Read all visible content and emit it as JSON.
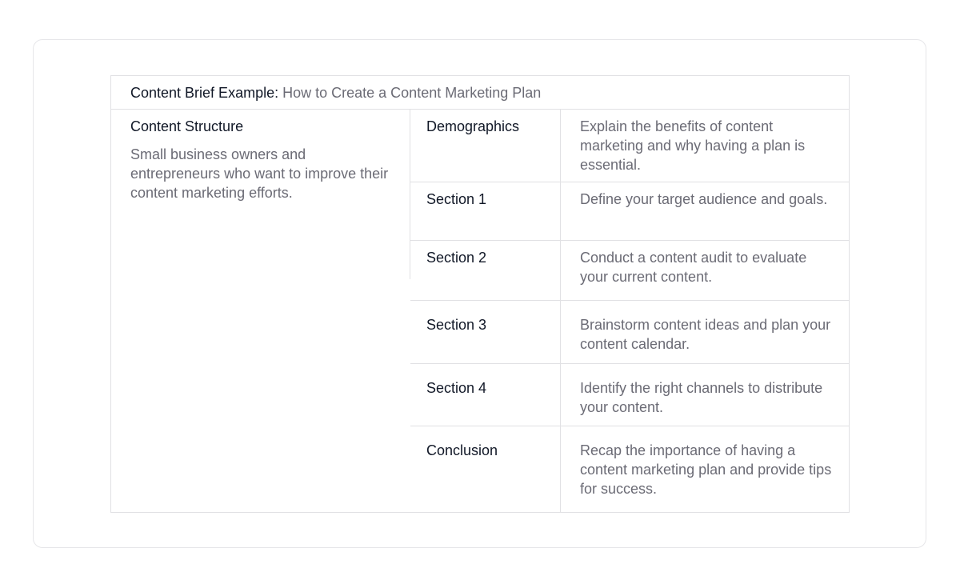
{
  "brief": {
    "header_label": "Content Brief Example:",
    "header_value": "How to Create a Content Marketing Plan"
  },
  "structure": {
    "title": "Content Structure",
    "description": "Small business owners and entrepreneurs who want to improve their content marketing efforts."
  },
  "rows": [
    {
      "name": "Demographics",
      "description": "Explain the benefits of content marketing and why having a plan is essential."
    },
    {
      "name": "Section 1",
      "description": "Define your target audience and goals."
    },
    {
      "name": "Section 2",
      "description": "Conduct a content audit to evaluate your current content."
    },
    {
      "name": "Section 3",
      "description": "Brainstorm content ideas and plan your content calendar."
    },
    {
      "name": "Section 4",
      "description": "Identify the right channels to distribute your content."
    },
    {
      "name": "Conclusion",
      "description": "Recap the importance of having a content marketing plan and provide tips for success."
    }
  ],
  "colors": {
    "text_primary": "#111827",
    "text_secondary": "#6b6b75",
    "border": "#e1e1e4"
  }
}
